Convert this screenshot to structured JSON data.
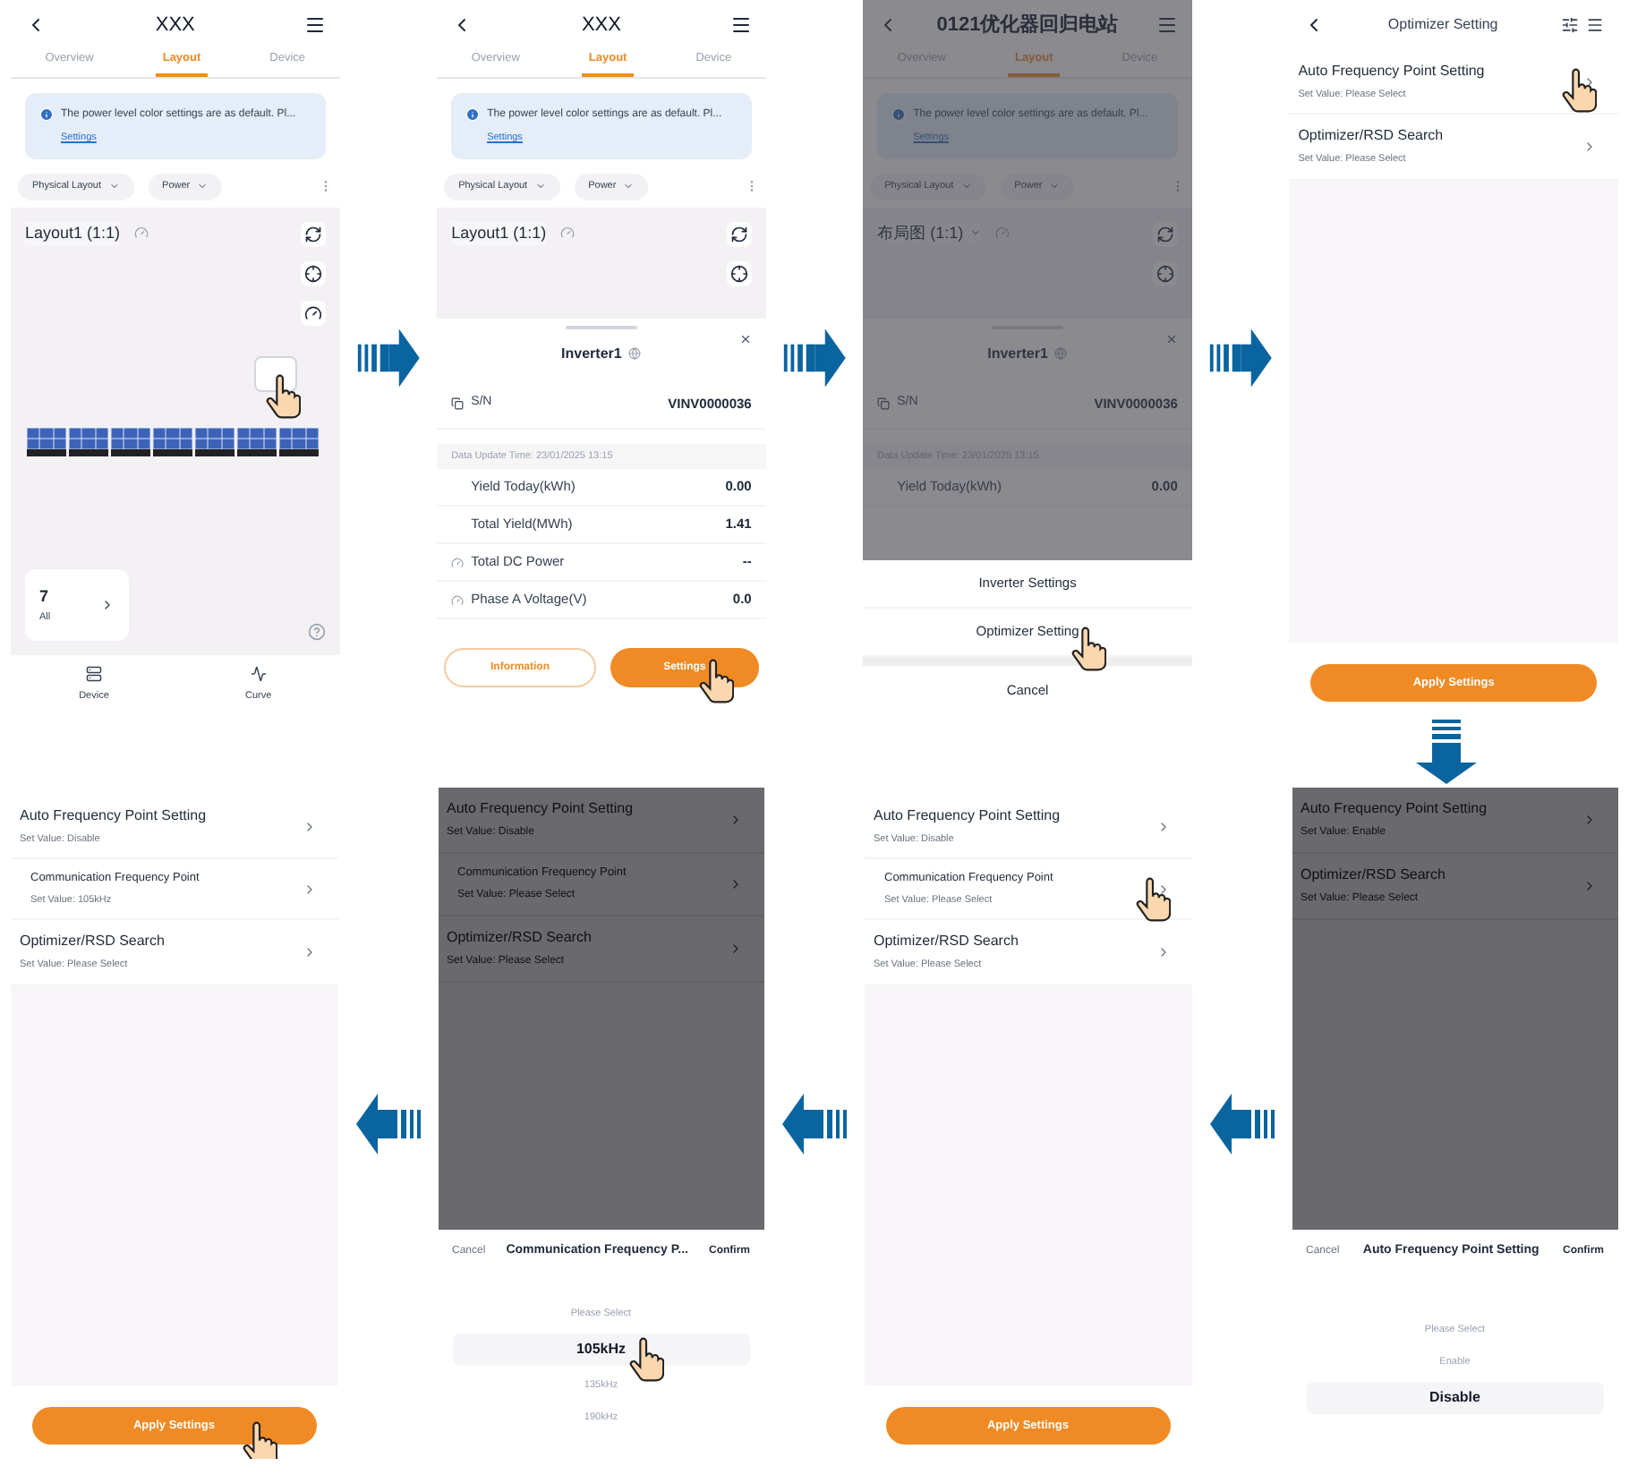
{
  "top_row": [
    {
      "kind": "layout",
      "header": {
        "title": "XXX"
      },
      "tabs": [
        {
          "label": "Overview",
          "selected": false
        },
        {
          "label": "Layout",
          "selected": true
        },
        {
          "label": "Device",
          "selected": false
        }
      ],
      "notice": {
        "text": "The power level color settings are as default. Pl...",
        "link": "Settings"
      },
      "filters": [
        "Physical Layout",
        "Power"
      ],
      "canvas": {
        "title": "Layout1 (1:1)",
        "dropdown": false
      },
      "summary": {
        "count": "7",
        "label": "All"
      },
      "nav": [
        {
          "label": "Device",
          "kind": "device"
        },
        {
          "label": "Curve",
          "kind": "curve"
        }
      ]
    },
    {
      "kind": "inverter_sheet",
      "header": {
        "title": "XXX"
      },
      "tabs": [
        {
          "label": "Overview",
          "selected": false
        },
        {
          "label": "Layout",
          "selected": true
        },
        {
          "label": "Device",
          "selected": false
        }
      ],
      "notice": {
        "text": "The power level color settings are as default. Pl...",
        "link": "Settings"
      },
      "filters": [
        "Physical Layout",
        "Power"
      ],
      "canvas": {
        "title": "Layout1 (1:1)",
        "dropdown": false
      },
      "sheet": {
        "title": "Inverter1",
        "sn_label": "S/N",
        "sn": "VINV0000036",
        "update": "Data Update Time: 23/01/2025 13:15",
        "rows": [
          {
            "label": "Yield Today(kWh)",
            "value": "0.00",
            "kind": "plain"
          },
          {
            "label": "Total Yield(MWh)",
            "value": "1.41",
            "kind": "plain"
          },
          {
            "label": "Total DC Power",
            "value": "--",
            "kind": "gauge"
          },
          {
            "label": "Phase A Voltage(V)",
            "value": "0.0",
            "kind": "gauge"
          }
        ]
      },
      "buttons": [
        {
          "label": "Information",
          "kind": "outline",
          "tapped": false
        },
        {
          "label": "Settings",
          "kind": "primary",
          "tapped": true
        }
      ]
    },
    {
      "kind": "action_sheet",
      "header": {
        "title": "0121优化器回归电站"
      },
      "tabs": [
        {
          "label": "Overview",
          "selected": false
        },
        {
          "label": "Layout",
          "selected": true
        },
        {
          "label": "Device",
          "selected": false
        }
      ],
      "notice": {
        "text": "The power level color settings are as default. Pl...",
        "link": "Settings"
      },
      "filters": [
        "Physical Layout",
        "Power"
      ],
      "canvas": {
        "title": "布局图 (1:1)",
        "dropdown": true
      },
      "sheet": {
        "title": "Inverter1",
        "sn_label": "S/N",
        "sn": "VINV0000036",
        "update": "Data Update Time: 23/01/2025 13:15",
        "rows": [
          {
            "label": "Yield Today(kWh)",
            "value": "0.00",
            "kind": "plain"
          }
        ]
      },
      "actions": [
        {
          "label": "Inverter Settings",
          "tapped": false
        },
        {
          "label": "Optimizer Setting",
          "tapped": true
        }
      ],
      "cancel": "Cancel"
    },
    {
      "kind": "settings_list",
      "header": {
        "title": "Optimizer Setting"
      },
      "items": [
        {
          "title": "Auto Frequency Point Setting",
          "value": "Set Value: Please Select",
          "sub": false,
          "tapped": true
        },
        {
          "title": "Optimizer/RSD Search",
          "value": "Set Value: Please Select",
          "sub": false,
          "tapped": false
        }
      ],
      "apply": {
        "label": "Apply Settings",
        "tapped": false
      }
    }
  ],
  "bottom_row": [
    {
      "kind": "settings_list",
      "items": [
        {
          "title": "Auto Frequency Point Setting",
          "value": "Set Value: Disable",
          "sub": false,
          "tapped": false
        },
        {
          "title": "Communication Frequency Point",
          "value": "Set Value: 105kHz",
          "sub": true,
          "tapped": false
        },
        {
          "title": "Optimizer/RSD Search",
          "value": "Set Value: Please Select",
          "sub": false,
          "tapped": false
        }
      ],
      "apply": {
        "label": "Apply Settings",
        "tapped": true
      }
    },
    {
      "kind": "picker",
      "items": [
        {
          "title": "Auto Frequency Point Setting",
          "value": "Set Value: Disable",
          "sub": false,
          "tapped": false
        },
        {
          "title": "Communication Frequency Point",
          "value": "Set Value: Please Select",
          "sub": true,
          "tapped": false
        },
        {
          "title": "Optimizer/RSD Search",
          "value": "Set Value: Please Select",
          "sub": false,
          "tapped": false
        }
      ],
      "picker": {
        "cancel": "Cancel",
        "title": "Communication Frequency P...",
        "confirm": "Confirm",
        "options": [
          {
            "label": "Please Select",
            "selected": false,
            "tapped": false
          },
          {
            "label": "105kHz",
            "selected": true,
            "tapped": true
          },
          {
            "label": "135kHz",
            "selected": false,
            "tapped": false
          },
          {
            "label": "190kHz",
            "selected": false,
            "tapped": false
          }
        ]
      }
    },
    {
      "kind": "settings_list",
      "items": [
        {
          "title": "Auto Frequency Point Setting",
          "value": "Set Value: Disable",
          "sub": false,
          "tapped": false
        },
        {
          "title": "Communication Frequency Point",
          "value": "Set Value: Please Select",
          "sub": true,
          "tapped": true
        },
        {
          "title": "Optimizer/RSD Search",
          "value": "Set Value: Please Select",
          "sub": false,
          "tapped": false
        }
      ],
      "apply": {
        "label": "Apply Settings",
        "tapped": false
      }
    },
    {
      "kind": "picker",
      "items": [
        {
          "title": "Auto Frequency Point Setting",
          "value": "Set Value: Enable",
          "sub": false,
          "tapped": false
        },
        {
          "title": "Optimizer/RSD Search",
          "value": "Set Value: Please Select",
          "sub": false,
          "tapped": false
        }
      ],
      "picker": {
        "cancel": "Cancel",
        "title": "Auto Frequency Point Setting",
        "confirm": "Confirm",
        "options": [
          {
            "label": "Please Select",
            "selected": false,
            "tapped": false
          },
          {
            "label": "Enable",
            "selected": false,
            "tapped": false
          },
          {
            "label": "Disable",
            "selected": true,
            "tapped": false
          }
        ]
      }
    }
  ]
}
